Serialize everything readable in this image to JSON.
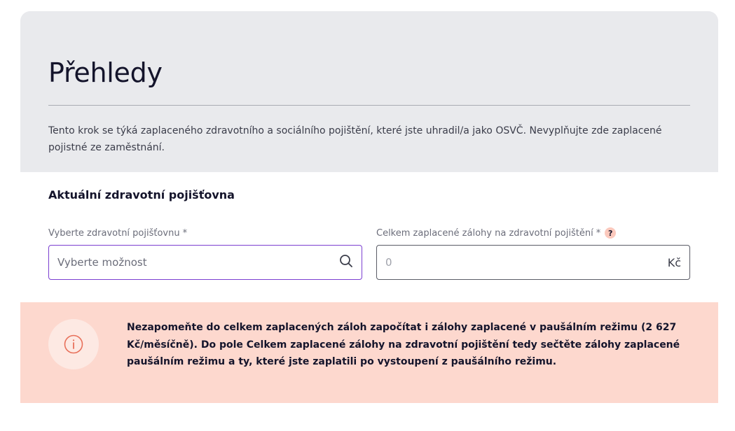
{
  "header": {
    "title": "Přehledy",
    "intro": "Tento krok se týká zaplaceného zdravotního a sociálního pojištění, které jste uhradil/a jako OSVČ. Nevyplňujte zde zaplacené pojistné ze zaměstnání."
  },
  "section": {
    "title": "Aktuální zdravotní pojišťovna"
  },
  "fields": {
    "insurer": {
      "label": "Vyberte zdravotní pojišťovnu",
      "required_mark": "*",
      "placeholder": "Vyberte možnost",
      "icon": "search-icon"
    },
    "amount": {
      "label": "Celkem zaplacené zálohy na zdravotní pojištění",
      "required_mark": "*",
      "help_glyph": "?",
      "value": "0",
      "unit": "Kč"
    }
  },
  "alert": {
    "icon": "info-icon",
    "text": "Nezapomeňte do celkem zaplacených záloh započítat i zálohy zaplacené v paušálním režimu (2 627 Kč/měsíčně). Do pole Celkem zaplacené zálohy na zdravotní pojištění tedy sečtěte zálohy zaplacené paušálním režimu a ty, které jste zaplatili po vystoupení z paušálního režimu."
  },
  "colors": {
    "header_bg": "#e9eaed",
    "alert_bg": "#fdd8ce",
    "focus_border": "#7b3fd1",
    "accent_icon": "#e8705a"
  }
}
